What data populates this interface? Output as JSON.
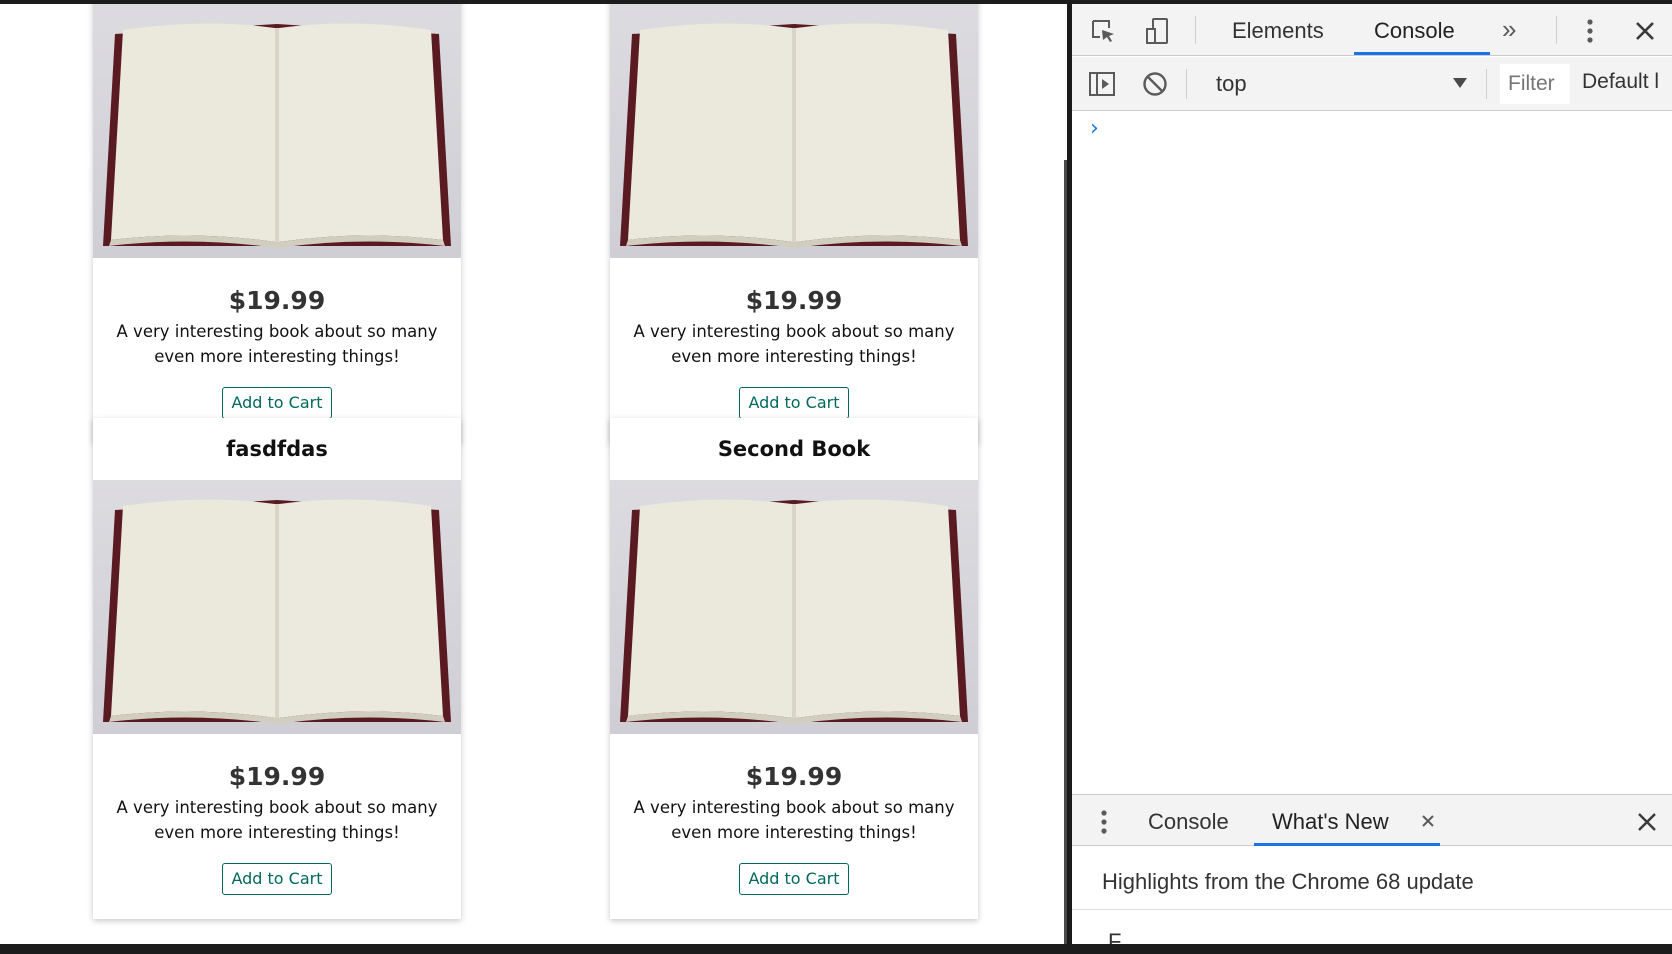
{
  "cards": [
    {
      "title": "",
      "price": "$19.99",
      "description": "A very interesting book about so many even more interesting things!",
      "button": "Add to Cart"
    },
    {
      "title": "",
      "price": "$19.99",
      "description": "A very interesting book about so many even more interesting things!",
      "button": "Add to Cart"
    },
    {
      "title": "fasdfdas",
      "price": "$19.99",
      "description": "A very interesting book about so many even more interesting things!",
      "button": "Add to Cart"
    },
    {
      "title": "Second Book",
      "price": "$19.99",
      "description": "A very interesting book about so many even more interesting things!",
      "button": "Add to Cart"
    }
  ],
  "devtools": {
    "tabs": [
      "Elements",
      "Console"
    ],
    "active_tab": "Console",
    "more_tabs_glyph": "»",
    "context": "top",
    "filter_placeholder": "Filter",
    "levels": "Default l",
    "prompt_glyph": "›",
    "drawer": {
      "tabs": [
        "Console",
        "What's New"
      ],
      "active_tab": "What's New",
      "heading": "Highlights from the Chrome 68 update",
      "subtext": "F"
    },
    "accent_color": "#1a73e8"
  },
  "colors": {
    "button_text": "#00695c",
    "book_cover": "#5a1a22"
  }
}
